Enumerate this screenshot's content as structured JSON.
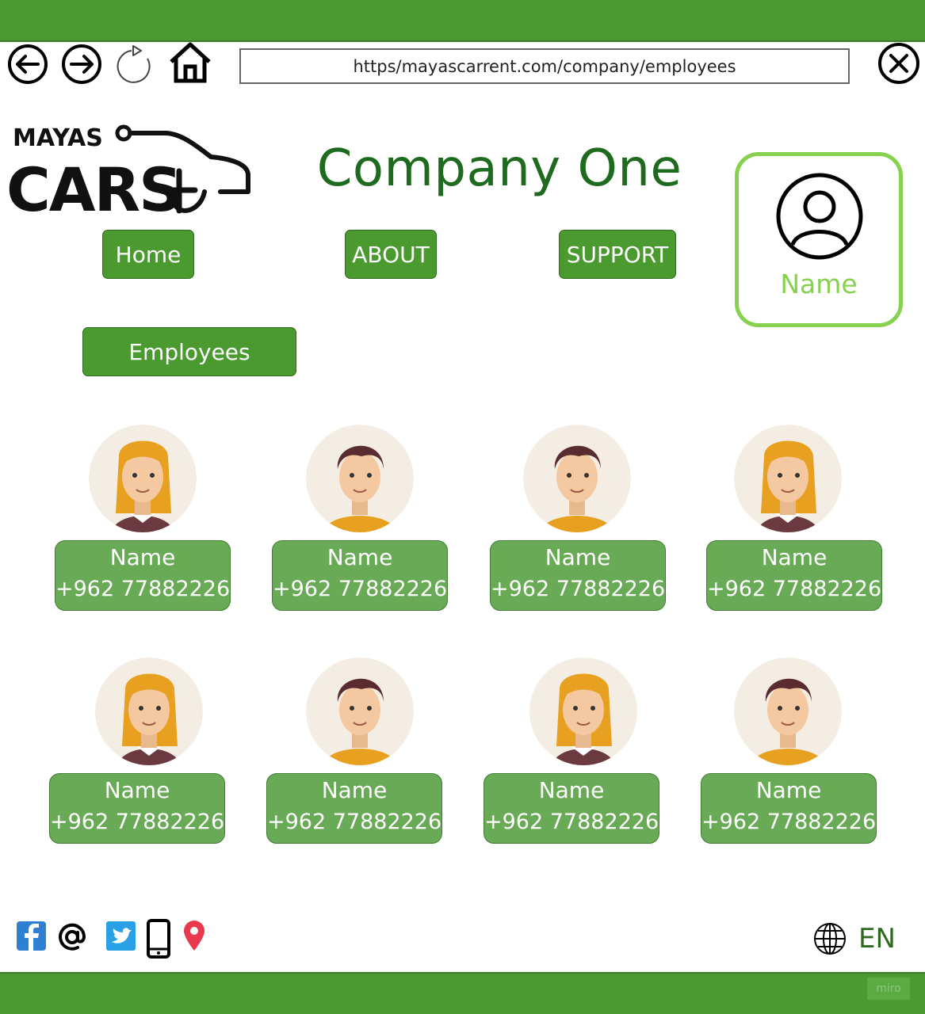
{
  "browser": {
    "url": "https/mayascarrent.com/company/employees"
  },
  "header": {
    "logo_top": "MAYAS",
    "logo_bottom": "CARS",
    "company_title": "Company One"
  },
  "nav": {
    "home": "Home",
    "about": "ABOUT",
    "support": "SUPPORT",
    "employees": "Employees"
  },
  "profile": {
    "name": "Name"
  },
  "employees": [
    {
      "name": "Name",
      "phone": "+962 77882226",
      "avatar": "female-avatar"
    },
    {
      "name": "Name",
      "phone": "+962 77882226",
      "avatar": "male-avatar"
    },
    {
      "name": "Name",
      "phone": "+962 77882226",
      "avatar": "male-avatar"
    },
    {
      "name": "Name",
      "phone": "+962 77882226",
      "avatar": "female-avatar"
    },
    {
      "name": "Name",
      "phone": "+962 77882226",
      "avatar": "female-avatar"
    },
    {
      "name": "Name",
      "phone": "+962 77882226",
      "avatar": "male-avatar"
    },
    {
      "name": "Name",
      "phone": "+962 77882226",
      "avatar": "female-avatar"
    },
    {
      "name": "Name",
      "phone": "+962 77882226",
      "avatar": "male-avatar"
    }
  ],
  "footer": {
    "social_icons": [
      "facebook-icon",
      "at-email-icon",
      "twitter-icon",
      "mobile-phone-icon",
      "location-pin-icon"
    ],
    "language": "EN",
    "watermark": "miro"
  },
  "colors": {
    "brand_green": "#4a9a30",
    "card_green": "#69aa56",
    "title_green": "#1e6a1e",
    "profile_green": "#86d24e"
  }
}
